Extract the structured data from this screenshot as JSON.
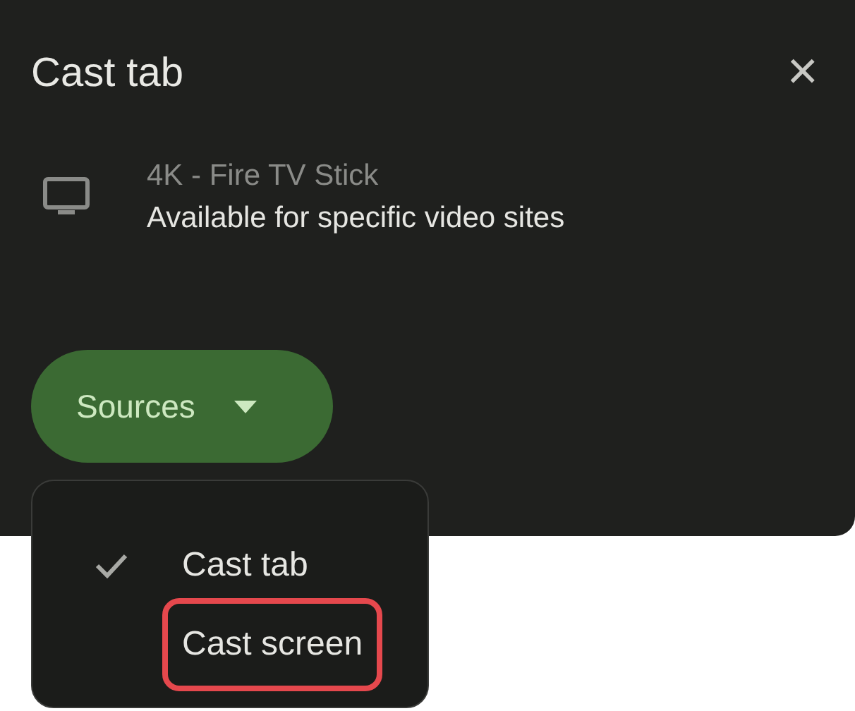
{
  "dialog": {
    "title": "Cast tab",
    "close": "×"
  },
  "devices": [
    {
      "name": "4K - Fire TV Stick",
      "status": "Available for specific video sites"
    }
  ],
  "sources_button": {
    "label": "Sources",
    "expanded": true
  },
  "sources_menu": [
    {
      "label": "Cast tab",
      "checked": true,
      "highlighted": false
    },
    {
      "label": "Cast screen",
      "checked": false,
      "highlighted": true
    }
  ]
}
